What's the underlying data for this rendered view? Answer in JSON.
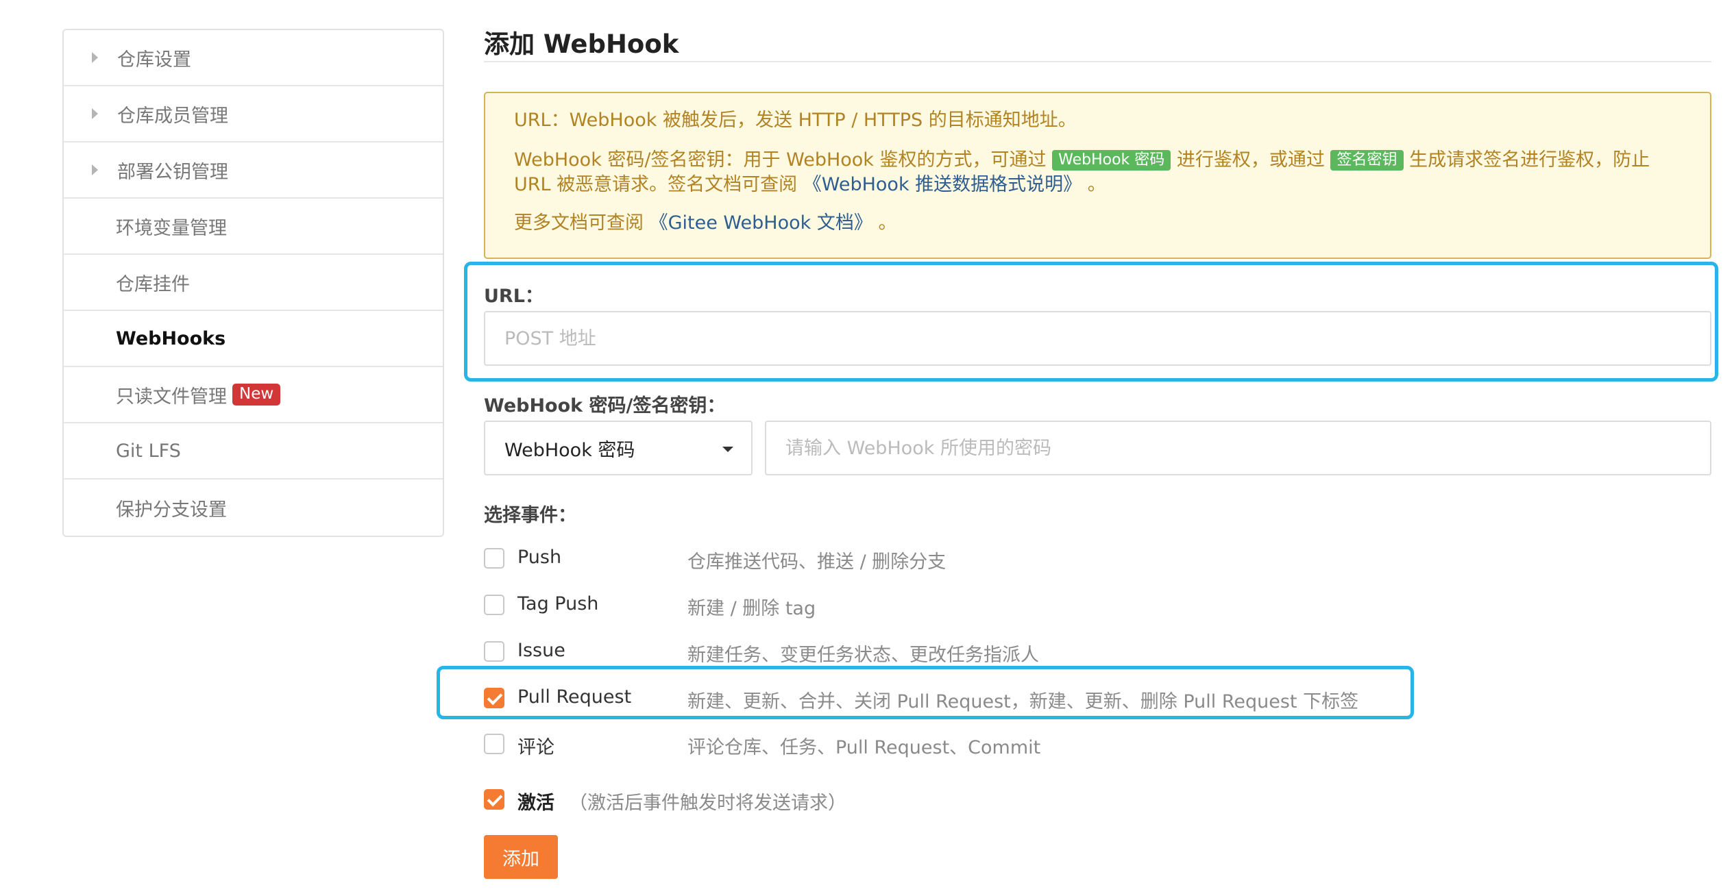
{
  "sidebar": {
    "items": [
      {
        "label": "仓库设置",
        "arrow": true,
        "active": false
      },
      {
        "label": "仓库成员管理",
        "arrow": true,
        "active": false
      },
      {
        "label": "部署公钥管理",
        "arrow": true,
        "active": false
      },
      {
        "label": "环境变量管理",
        "arrow": false,
        "active": false
      },
      {
        "label": "仓库挂件",
        "arrow": false,
        "active": false
      },
      {
        "label": "WebHooks",
        "arrow": false,
        "active": true
      },
      {
        "label": "只读文件管理",
        "arrow": false,
        "active": false,
        "badge": "New"
      },
      {
        "label": "Git LFS",
        "arrow": false,
        "active": false
      },
      {
        "label": "保护分支设置",
        "arrow": false,
        "active": false
      }
    ]
  },
  "main": {
    "title": "添加 WebHook",
    "notice": {
      "line1": "URL：WebHook 被触发后，发送 HTTP / HTTPS 的目标通知地址。",
      "line2_a": "WebHook 密码/签名密钥：用于 WebHook 鉴权的方式，可通过",
      "tag_password": "WebHook 密码",
      "line2_b": "进行鉴权，或通过",
      "tag_sign": "签名密钥",
      "line2_c": "生成请求签名进行鉴权，防止 URL 被恶意请求。签名文档可查阅",
      "link_format": "《WebHook 推送数据格式说明》",
      "line2_end": "。",
      "line3_a": "更多文档可查阅",
      "link_docs": "《Gitee WebHook 文档》",
      "line3_end": "。"
    },
    "url": {
      "label": "URL：",
      "placeholder": "POST 地址",
      "value": ""
    },
    "secret": {
      "label": "WebHook 密码/签名密钥：",
      "selected": "WebHook 密码",
      "placeholder": "请输入 WebHook 所使用的密码",
      "value": ""
    },
    "events": {
      "label": "选择事件：",
      "items": [
        {
          "name": "Push",
          "desc": "仓库推送代码、推送 / 删除分支",
          "checked": false
        },
        {
          "name": "Tag Push",
          "desc": "新建 / 删除 tag",
          "checked": false
        },
        {
          "name": "Issue",
          "desc": "新建任务、变更任务状态、更改任务指派人",
          "checked": false
        },
        {
          "name": "Pull Request",
          "desc": "新建、更新、合并、关闭 Pull Request，新建、更新、删除 Pull Request 下标签",
          "checked": true
        },
        {
          "name": "评论",
          "desc": "评论仓库、任务、Pull Request、Commit",
          "checked": false
        }
      ]
    },
    "activate": {
      "label": "激活",
      "note": "（激活后事件触发时将发送请求）",
      "checked": true
    },
    "add_button": "添加"
  },
  "colors": {
    "accent": "#f57b33",
    "highlight": "#27b4e6",
    "notice_bg": "#fef9e1",
    "notice_text": "#b18323",
    "tag_green": "#5cb85c",
    "badge_red": "#d23636"
  }
}
